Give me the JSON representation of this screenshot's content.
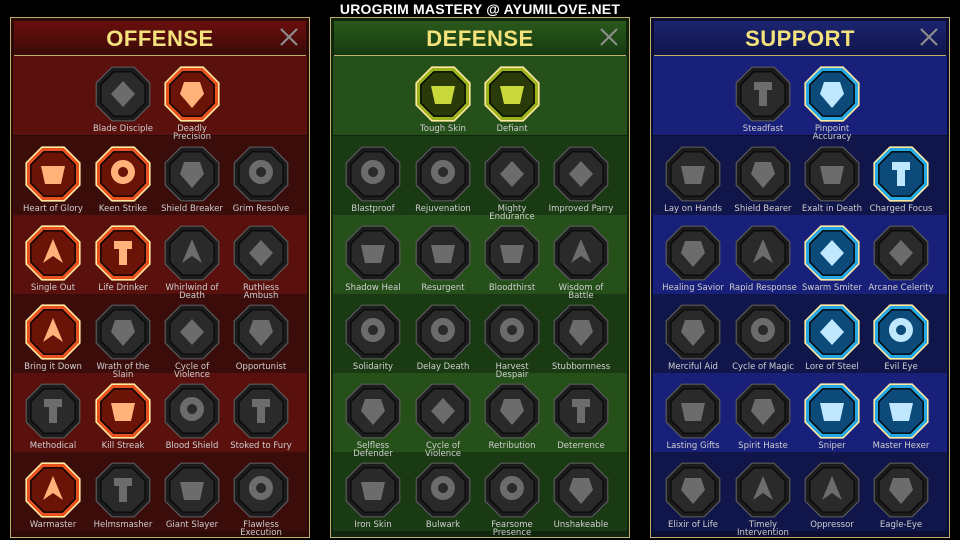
{
  "site_title": "UROGRIM MASTERY @ AYUMILOVE.NET",
  "colors": {
    "title_gold": "#f4e27c",
    "offense_active": "#e8501e",
    "defense_active": "#9ab21c",
    "support_active": "#26a8e4",
    "inactive": "#3a3a3a"
  },
  "panels": [
    {
      "key": "offense",
      "title": "OFFENSE",
      "rows": [
        [
          {
            "label": "Blade Disciple",
            "icon": "crossed-swords-icon",
            "active": false
          },
          {
            "label": "Deadly Precision",
            "icon": "dagger-strike-icon",
            "active": true
          }
        ],
        [
          {
            "label": "Heart of Glory",
            "icon": "horned-figure-icon",
            "active": true
          },
          {
            "label": "Keen Strike",
            "icon": "blade-slash-icon",
            "active": true
          },
          {
            "label": "Shield Breaker",
            "icon": "broken-shield-icon",
            "active": false
          },
          {
            "label": "Grim Resolve",
            "icon": "grim-heart-icon",
            "active": false
          }
        ],
        [
          {
            "label": "Single Out",
            "icon": "arrows-target-icon",
            "active": true
          },
          {
            "label": "Life Drinker",
            "icon": "fanged-mouth-icon",
            "active": true
          },
          {
            "label": "Whirlwind of Death",
            "icon": "whirlwind-icon",
            "active": false
          },
          {
            "label": "Ruthless Ambush",
            "icon": "hand-dagger-icon",
            "active": false
          }
        ],
        [
          {
            "label": "Bring it Down",
            "icon": "sword-down-icon",
            "active": true
          },
          {
            "label": "Wrath of the Slain",
            "icon": "fist-hammer-icon",
            "active": false
          },
          {
            "label": "Cycle of Violence",
            "icon": "axe-icon",
            "active": false
          },
          {
            "label": "Opportunist",
            "icon": "chain-bolt-icon",
            "active": false
          }
        ],
        [
          {
            "label": "Methodical",
            "icon": "spider-icon",
            "active": false
          },
          {
            "label": "Kill Streak",
            "icon": "skull-icon",
            "active": true
          },
          {
            "label": "Blood Shield",
            "icon": "blood-shield-icon",
            "active": false
          },
          {
            "label": "Stoked to Fury",
            "icon": "fury-figure-icon",
            "active": false
          }
        ],
        [
          {
            "label": "Warmaster",
            "icon": "warmaster-icon",
            "active": true
          },
          {
            "label": "Helmsmasher",
            "icon": "helmet-icon",
            "active": false
          },
          {
            "label": "Giant Slayer",
            "icon": "giant-icon",
            "active": false
          },
          {
            "label": "Flawless Execution",
            "icon": "execution-skull-icon",
            "active": false
          }
        ]
      ]
    },
    {
      "key": "defense",
      "title": "DEFENSE",
      "rows": [
        [
          {
            "label": "Tough Skin",
            "icon": "armor-plates-icon",
            "active": true
          },
          {
            "label": "Defiant",
            "icon": "raised-fist-icon",
            "active": true
          }
        ],
        [
          {
            "label": "Blastproof",
            "icon": "blast-shield-icon",
            "active": false
          },
          {
            "label": "Rejuvenation",
            "icon": "heart-hand-icon",
            "active": false
          },
          {
            "label": "Mighty Endurance",
            "icon": "muscle-figure-icon",
            "active": false
          },
          {
            "label": "Improved Parry",
            "icon": "parry-blades-icon",
            "active": false
          }
        ],
        [
          {
            "label": "Shadow Heal",
            "icon": "shadow-figure-icon",
            "active": false
          },
          {
            "label": "Resurgent",
            "icon": "knight-icon",
            "active": false
          },
          {
            "label": "Bloodthirst",
            "icon": "blood-heart-icon",
            "active": false
          },
          {
            "label": "Wisdom of Battle",
            "icon": "sage-icon",
            "active": false
          }
        ],
        [
          {
            "label": "Solidarity",
            "icon": "solidarity-icon",
            "active": false
          },
          {
            "label": "Delay Death",
            "icon": "hourglass-icon",
            "active": false
          },
          {
            "label": "Harvest Despair",
            "icon": "open-hand-icon",
            "active": false
          },
          {
            "label": "Stubbornness",
            "icon": "bull-icon",
            "active": false
          }
        ],
        [
          {
            "label": "Selfless Defender",
            "icon": "defender-icon",
            "active": false
          },
          {
            "label": "Cycle of Violence",
            "icon": "claws-icon",
            "active": false
          },
          {
            "label": "Retribution",
            "icon": "retribution-skull-icon",
            "active": false
          },
          {
            "label": "Deterrence",
            "icon": "deterrence-icon",
            "active": false
          }
        ],
        [
          {
            "label": "Iron Skin",
            "icon": "iron-figure-icon",
            "active": false
          },
          {
            "label": "Bulwark",
            "icon": "bulwark-shield-icon",
            "active": false
          },
          {
            "label": "Fearsome Presence",
            "icon": "fearsome-face-icon",
            "active": false
          },
          {
            "label": "Unshakeable",
            "icon": "unshakeable-icon",
            "active": false
          }
        ]
      ]
    },
    {
      "key": "support",
      "title": "SUPPORT",
      "rows": [
        [
          {
            "label": "Steadfast",
            "icon": "plus-heart-icon",
            "active": false
          },
          {
            "label": "Pinpoint Accuracy",
            "icon": "target-arrow-icon",
            "active": true
          }
        ],
        [
          {
            "label": "Lay on Hands",
            "icon": "praying-hands-icon",
            "active": false
          },
          {
            "label": "Shield Bearer",
            "icon": "shield-rings-icon",
            "active": false
          },
          {
            "label": "Exalt in Death",
            "icon": "flame-skull-icon",
            "active": false
          },
          {
            "label": "Charged Focus",
            "icon": "charged-focus-icon",
            "active": true
          }
        ],
        [
          {
            "label": "Healing Savior",
            "icon": "healing-figure-icon",
            "active": false
          },
          {
            "label": "Rapid Response",
            "icon": "lightning-shield-icon",
            "active": false
          },
          {
            "label": "Swarm Smiter",
            "icon": "swarm-bolt-icon",
            "active": true
          },
          {
            "label": "Arcane Celerity",
            "icon": "arcane-figures-icon",
            "active": false
          }
        ],
        [
          {
            "label": "Merciful Aid",
            "icon": "chained-heart-icon",
            "active": false
          },
          {
            "label": "Cycle of Magic",
            "icon": "comet-icon",
            "active": false
          },
          {
            "label": "Lore of Steel",
            "icon": "open-book-icon",
            "active": true
          },
          {
            "label": "Evil Eye",
            "icon": "evil-face-icon",
            "active": true
          }
        ],
        [
          {
            "label": "Lasting Gifts",
            "icon": "star-compass-icon",
            "active": false
          },
          {
            "label": "Spirit Haste",
            "icon": "winged-boot-icon",
            "active": false
          },
          {
            "label": "Sniper",
            "icon": "eye-icon",
            "active": true
          },
          {
            "label": "Master Hexer",
            "icon": "hexer-figure-icon",
            "active": true
          }
        ],
        [
          {
            "label": "Elixir of Life",
            "icon": "potion-flask-icon",
            "active": false
          },
          {
            "label": "Timely Intervention",
            "icon": "timely-skull-icon",
            "active": false
          },
          {
            "label": "Oppressor",
            "icon": "crushing-fist-icon",
            "active": false
          },
          {
            "label": "Eagle-Eye",
            "icon": "eagle-head-icon",
            "active": false
          }
        ]
      ]
    }
  ]
}
